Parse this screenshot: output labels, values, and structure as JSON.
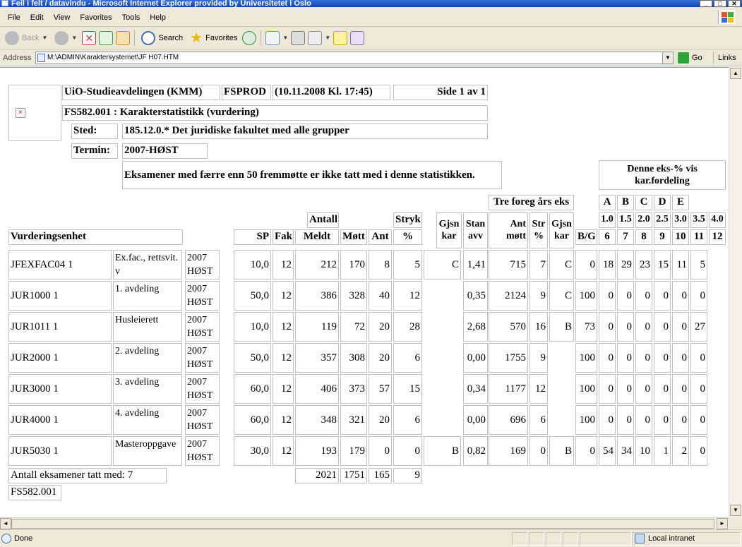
{
  "window": {
    "title": "Feil i felt / datavindu - Microsoft Internet Explorer provided by Universitetet i Oslo",
    "buttons": [
      "_",
      "□",
      "✕"
    ]
  },
  "menu": [
    "File",
    "Edit",
    "View",
    "Favorites",
    "Tools",
    "Help"
  ],
  "toolbar": {
    "back": "Back",
    "search": "Search",
    "favorites": "Favorites"
  },
  "address": {
    "label": "Address",
    "value": "M:\\ADMIN\\Karaktersystemet\\JF H07.HTM",
    "go": "Go",
    "links": "Links"
  },
  "status": {
    "text": "Done",
    "zone": "Local intranet"
  },
  "report": {
    "org": "UiO-Studieavdelingen (KMM)",
    "system": "FSPROD",
    "timestamp": "(10.11.2008 Kl. 17:45)",
    "page": "Side 1 av 1",
    "report_title": "FS582.001 : Karakterstatistikk (vurdering)",
    "sted_label": "Sted:",
    "sted": "185.12.0.* Det juridiske fakultet med alle grupper",
    "termin_label": "Termin:",
    "termin": "2007-HØST",
    "note": "Eksamener med færre enn 50 fremmøtte er ikke tatt med i denne statistikken.",
    "dist_header": "Denne eks-% vis kar.fordeling",
    "prev_header": "Tre foreg års eks",
    "antall_header": "Antall",
    "stryk_header": "Stryk",
    "headers": {
      "unit": "Vurderingsenhet",
      "sp": "SP",
      "fak": "Fak",
      "meldt": "Meldt",
      "mott": "Møtt",
      "ant": "Ant",
      "pct": "%",
      "gjsn": "Gjsn kar",
      "stan": "Stan avv",
      "antmott": "Ant møtt",
      "str": "Str %",
      "gjsn2": "Gjsn kar",
      "bg": "B/G"
    },
    "letters": [
      "A",
      "B",
      "C",
      "D",
      "E"
    ],
    "numgrades": [
      "1.0",
      "1.5",
      "2.0",
      "2.5",
      "3.0",
      "3.5",
      "4.0"
    ],
    "dist_cols": [
      "6",
      "7",
      "8",
      "9",
      "10",
      "11",
      "12"
    ],
    "rows": [
      {
        "code": "JFEXFAC04 1",
        "name": "Ex.fac., rettsvit. v",
        "term": "2007 HØST",
        "sp": "10,0",
        "fak": "12",
        "meldt": "212",
        "mott": "170",
        "ant": "8",
        "pct": "5",
        "gjsn": "C",
        "stan": "1,41",
        "antmott": "715",
        "str": "7",
        "gjsn2": "C",
        "bg": "0",
        "dist": [
          "18",
          "29",
          "23",
          "15",
          "11",
          "5"
        ]
      },
      {
        "code": "JUR1000 1",
        "name": "1. avdeling",
        "term": "2007 HØST",
        "sp": "50,0",
        "fak": "12",
        "meldt": "386",
        "mott": "328",
        "ant": "40",
        "pct": "12",
        "gjsn": "",
        "stan": "0,35",
        "antmott": "2124",
        "str": "9",
        "gjsn2": "C",
        "bg": "100",
        "dist": [
          "0",
          "0",
          "0",
          "0",
          "0",
          "0"
        ]
      },
      {
        "code": "JUR1011 1",
        "name": "Husleierett",
        "term": "2007 HØST",
        "sp": "10,0",
        "fak": "12",
        "meldt": "119",
        "mott": "72",
        "ant": "20",
        "pct": "28",
        "gjsn": "",
        "stan": "2,68",
        "antmott": "570",
        "str": "16",
        "gjsn2": "B",
        "bg": "73",
        "dist": [
          "0",
          "0",
          "0",
          "0",
          "0",
          "27"
        ]
      },
      {
        "code": "JUR2000 1",
        "name": "2. avdeling",
        "term": "2007 HØST",
        "sp": "50,0",
        "fak": "12",
        "meldt": "357",
        "mott": "308",
        "ant": "20",
        "pct": "6",
        "gjsn": "",
        "stan": "0,00",
        "antmott": "1755",
        "str": "9",
        "gjsn2": "",
        "bg": "100",
        "dist": [
          "0",
          "0",
          "0",
          "0",
          "0",
          "0"
        ]
      },
      {
        "code": "JUR3000 1",
        "name": "3. avdeling",
        "term": "2007 HØST",
        "sp": "60,0",
        "fak": "12",
        "meldt": "406",
        "mott": "373",
        "ant": "57",
        "pct": "15",
        "gjsn": "",
        "stan": "0,34",
        "antmott": "1177",
        "str": "12",
        "gjsn2": "",
        "bg": "100",
        "dist": [
          "0",
          "0",
          "0",
          "0",
          "0",
          "0"
        ]
      },
      {
        "code": "JUR4000 1",
        "name": "4. avdeling",
        "term": "2007 HØST",
        "sp": "60,0",
        "fak": "12",
        "meldt": "348",
        "mott": "321",
        "ant": "20",
        "pct": "6",
        "gjsn": "",
        "stan": "0,00",
        "antmott": "696",
        "str": "6",
        "gjsn2": "",
        "bg": "100",
        "dist": [
          "0",
          "0",
          "0",
          "0",
          "0",
          "0"
        ]
      },
      {
        "code": "JUR5030 1",
        "name": "Masteroppgave",
        "term": "2007 HØST",
        "sp": "30,0",
        "fak": "12",
        "meldt": "193",
        "mott": "179",
        "ant": "0",
        "pct": "0",
        "gjsn": "B",
        "stan": "0,82",
        "antmott": "169",
        "str": "0",
        "gjsn2": "B",
        "bg": "0",
        "dist": [
          "54",
          "34",
          "10",
          "1",
          "2",
          "0"
        ]
      }
    ],
    "totals": {
      "label": "Antall eksamener tatt med: 7",
      "meldt": "2021",
      "mott": "1751",
      "ant": "165",
      "pct": "9"
    },
    "footer": "FS582.001"
  }
}
